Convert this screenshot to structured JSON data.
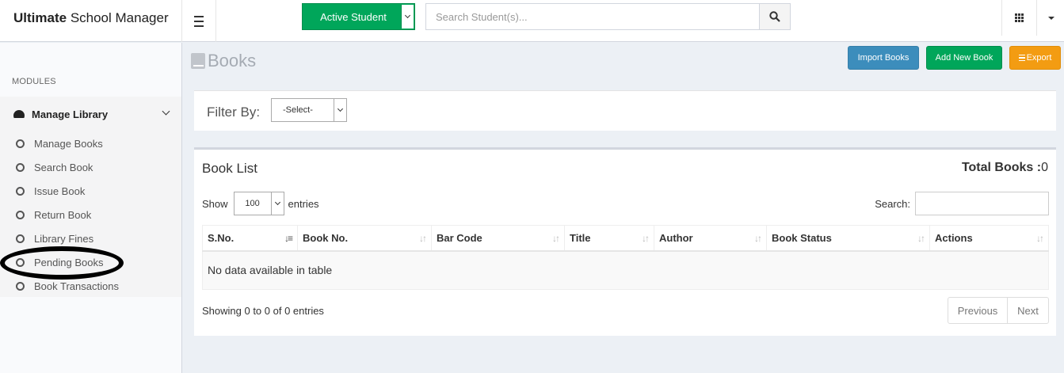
{
  "app": {
    "brand_bold": "Ultimate",
    "brand_rest": "School Manager"
  },
  "header": {
    "student_filter": "Active Student",
    "search_placeholder": "Search Student(s)..."
  },
  "sidebar": {
    "modules_label": "MODULES",
    "section_title": "Manage Library",
    "items": [
      {
        "label": "Manage Books"
      },
      {
        "label": "Search Book"
      },
      {
        "label": "Issue Book"
      },
      {
        "label": "Return Book"
      },
      {
        "label": "Library Fines"
      },
      {
        "label": "Pending Books"
      },
      {
        "label": "Book Transactions"
      }
    ]
  },
  "page": {
    "title": "Books",
    "buttons": {
      "import": "Import Books",
      "add": "Add New Book",
      "export": "Export"
    }
  },
  "filter": {
    "label": "Filter By:",
    "selected": "-Select-"
  },
  "book_list": {
    "title": "Book List",
    "total_label": "Total Books :",
    "total_value": "0",
    "show_label": "Show",
    "entries_value": "100",
    "entries_label": "entries",
    "search_label": "Search:",
    "columns": [
      "S.No.",
      "Book No.",
      "Bar Code",
      "Title",
      "Author",
      "Book Status",
      "Actions"
    ],
    "empty_message": "No data available in table",
    "showing_text": "Showing 0 to 0 of 0 entries",
    "pager": {
      "previous": "Previous",
      "next": "Next"
    }
  },
  "colors": {
    "green": "#00a65a",
    "blue": "#3c8dbc",
    "orange": "#f39c12"
  },
  "icons": [
    "hamburger-icon",
    "search-icon",
    "apps-grid-icon",
    "dashboard-icon",
    "book-icon",
    "list-icon",
    "sort-icon"
  ]
}
